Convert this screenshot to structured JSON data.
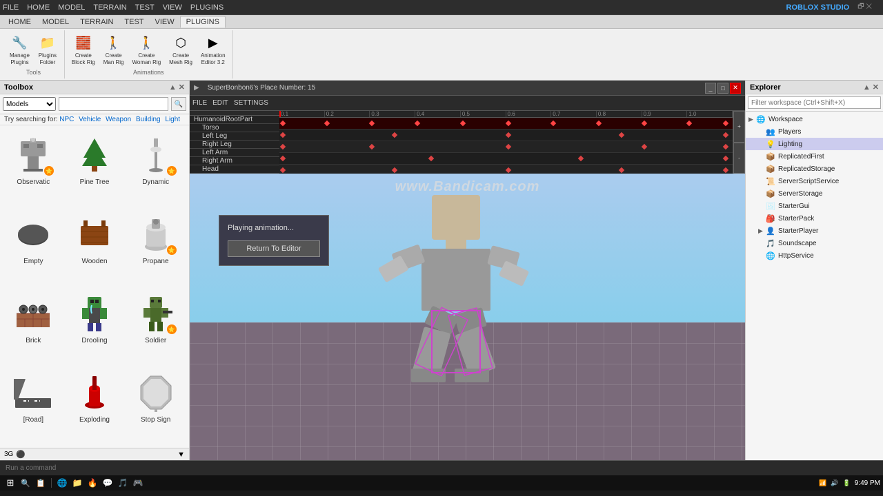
{
  "watermark": "www.Bandicam.com",
  "topbar": {
    "items": [
      "FILE",
      "HOME",
      "MODEL",
      "TERRAIN",
      "TEST",
      "VIEW",
      "PLUGINS"
    ]
  },
  "ribbon": {
    "sections": [
      {
        "label": "Tools",
        "buttons": [
          {
            "label": "Manage\nPlugins",
            "icon": "🔧"
          },
          {
            "label": "Plugins\nFolder",
            "icon": "📁"
          }
        ]
      },
      {
        "label": "",
        "buttons": [
          {
            "label": "Create\nBlock Rig",
            "icon": "🧱"
          },
          {
            "label": "Create\nMan Rig",
            "icon": "🚶"
          },
          {
            "label": "Create\nWoman Rig",
            "icon": "🚶"
          },
          {
            "label": "Create\nMesh Rig",
            "icon": "⬡"
          },
          {
            "label": "Animation\nEditor 3.2",
            "icon": "▶"
          }
        ]
      }
    ],
    "animations_label": "Animations"
  },
  "toolbox": {
    "title": "Toolbox",
    "search_placeholder": "",
    "dropdown_value": "Models",
    "suggestions_label": "Try searching for:",
    "suggestions": [
      "NPC",
      "Vehicle",
      "Weapon",
      "Building",
      "Light"
    ],
    "items": [
      {
        "label": "Observatic",
        "icon": "tower",
        "badge": true
      },
      {
        "label": "Pine Tree",
        "icon": "pine",
        "badge": false
      },
      {
        "label": "Dynamic",
        "icon": "lamp",
        "badge": true
      },
      {
        "label": "Empty",
        "icon": "empty",
        "badge": false
      },
      {
        "label": "Wooden",
        "icon": "wooden",
        "badge": false
      },
      {
        "label": "Propane",
        "icon": "propane",
        "badge": true
      },
      {
        "label": "Brick",
        "icon": "brick",
        "badge": false
      },
      {
        "label": "Drooling",
        "icon": "drooling",
        "badge": false
      },
      {
        "label": "Soldier",
        "icon": "soldier",
        "badge": true
      },
      {
        "label": "[Road]",
        "icon": "road",
        "badge": false
      },
      {
        "label": "Exploding",
        "icon": "exploding",
        "badge": false
      },
      {
        "label": "Stop Sign",
        "icon": "stopsign",
        "badge": false
      }
    ]
  },
  "animation_editor": {
    "title": "SuperBonbon6's Place Number: 15",
    "menu": [
      "FILE",
      "EDIT",
      "SETTINGS"
    ],
    "bones": [
      "HumanoidRootPart",
      "Torso",
      "Left Leg",
      "Right Leg",
      "Left Arm",
      "Right Arm",
      "Head"
    ],
    "ticks": [
      "0.1",
      "0.2",
      "0.3",
      "0.4",
      "0.5",
      "0.6",
      "0.7",
      "0.8",
      "0.9",
      "1.0"
    ]
  },
  "popup": {
    "text": "Playing animation...",
    "button": "Return To Editor"
  },
  "explorer": {
    "title": "Explorer",
    "search_placeholder": "Filter workspace (Ctrl+Shift+X)",
    "items": [
      {
        "label": "Workspace",
        "indent": 0,
        "has_arrow": true,
        "icon": "workspace"
      },
      {
        "label": "Players",
        "indent": 1,
        "has_arrow": false,
        "icon": "players"
      },
      {
        "label": "Lighting",
        "indent": 1,
        "has_arrow": false,
        "icon": "lighting",
        "highlighted": true
      },
      {
        "label": "ReplicatedFirst",
        "indent": 1,
        "has_arrow": false,
        "icon": "folder"
      },
      {
        "label": "ReplicatedStorage",
        "indent": 1,
        "has_arrow": false,
        "icon": "folder"
      },
      {
        "label": "ServerScriptService",
        "indent": 1,
        "has_arrow": false,
        "icon": "folder"
      },
      {
        "label": "ServerStorage",
        "indent": 1,
        "has_arrow": false,
        "icon": "folder"
      },
      {
        "label": "StarterGui",
        "indent": 1,
        "has_arrow": false,
        "icon": "folder"
      },
      {
        "label": "StarterPack",
        "indent": 1,
        "has_arrow": false,
        "icon": "folder"
      },
      {
        "label": "StarterPlayer",
        "indent": 1,
        "has_arrow": true,
        "icon": "folder"
      },
      {
        "label": "Soundscape",
        "indent": 1,
        "has_arrow": false,
        "icon": "folder"
      },
      {
        "label": "HttpService",
        "indent": 1,
        "has_arrow": false,
        "icon": "folder"
      }
    ]
  },
  "bottom_bar": {
    "placeholder": "Run a command"
  },
  "taskbar": {
    "time": "9:49 PM",
    "icons": [
      "⊞",
      "🔍",
      "📋",
      "🌐",
      "📁",
      "🔥",
      "💬",
      "🎵",
      "🖥"
    ]
  },
  "viewport_label": "3G"
}
